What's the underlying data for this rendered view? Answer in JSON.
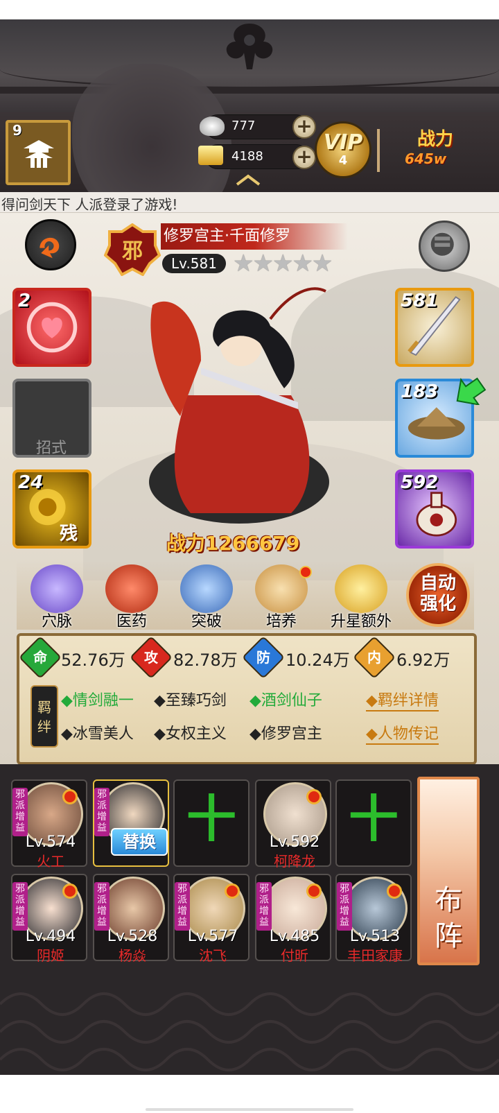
{
  "player": {
    "level": "9"
  },
  "currency": {
    "silver": "777",
    "gold": "4188",
    "silver_icon": "silver-ingot-icon",
    "gold_icon": "gold-bars-icon",
    "add_symbol": "+"
  },
  "vip": {
    "label": "VIP",
    "level": "4"
  },
  "top_power": {
    "label": "战力",
    "value": "645w"
  },
  "ticker": {
    "text": "得问剑天下 人派登录了游戏!"
  },
  "hero": {
    "name": "修罗宫主·千面修罗",
    "level_label": "Lv.581",
    "stars": "★★★★★",
    "power_label": "战力",
    "power_value": "1266679"
  },
  "left_slots": [
    {
      "number": "2",
      "icon": "heart-skill-icon"
    },
    {
      "label": "招式",
      "icon": "empty-move-icon"
    },
    {
      "number": "24",
      "icon": "golden-flower-skill-icon",
      "mark": "残"
    }
  ],
  "right_slots": [
    {
      "number": "581",
      "icon": "sword-icon"
    },
    {
      "number": "183",
      "icon": "straw-hat-icon"
    },
    {
      "number": "592",
      "icon": "wine-pot-icon"
    }
  ],
  "actions": [
    {
      "label": "穴脉",
      "icon": "meridian-icon"
    },
    {
      "label": "医药",
      "icon": "mushroom-icon"
    },
    {
      "label": "突破",
      "icon": "breakthrough-icon"
    },
    {
      "label": "培养",
      "icon": "scroll-icon"
    },
    {
      "label": "升星额外",
      "icon": "star-up-icon"
    }
  ],
  "auto_enhance": {
    "line1": "自动",
    "line2": "强化"
  },
  "stats": [
    {
      "char": "命",
      "value": "52.76万",
      "color": "#26a83a"
    },
    {
      "char": "攻",
      "value": "82.78万",
      "color": "#d8281e"
    },
    {
      "char": "防",
      "value": "10.24万",
      "color": "#2a78d8"
    },
    {
      "char": "内",
      "value": "6.92万",
      "color": "#e8a030"
    }
  ],
  "bonds": {
    "tag_line1": "羁",
    "tag_line2": "绊",
    "row1": [
      "◆情剑融一",
      "◆至臻巧剑",
      "◆酒剑仙子"
    ],
    "row2": [
      "◆冰雪美人",
      "◆女权主义",
      "◆修罗宫主"
    ],
    "detail_link": "◆羁绊详情",
    "bio_link": "◆人物传记"
  },
  "team_row1": [
    {
      "level": "Lv.574",
      "name": "火工",
      "badge": "邪派增益"
    },
    {
      "replace_label": "替换",
      "badge": "邪派增益"
    },
    {
      "plus": "十"
    },
    {
      "level": "Lv.592",
      "name": "柯降龙"
    },
    {
      "plus": "十"
    }
  ],
  "team_row2": [
    {
      "level": "Lv.494",
      "name": "阴姬",
      "badge": "邪派增益"
    },
    {
      "level": "Lv.528",
      "name": "杨焱",
      "badge": "邪派增益"
    },
    {
      "level": "Lv.577",
      "name": "沈飞",
      "badge": "邪派增益"
    },
    {
      "level": "Lv.485",
      "name": "付昕",
      "badge": "邪派增益"
    },
    {
      "level": "Lv.513",
      "name": "丰田家康",
      "badge": "邪派增益"
    }
  ],
  "formation": {
    "label_line1": "布",
    "label_line2": "阵"
  }
}
